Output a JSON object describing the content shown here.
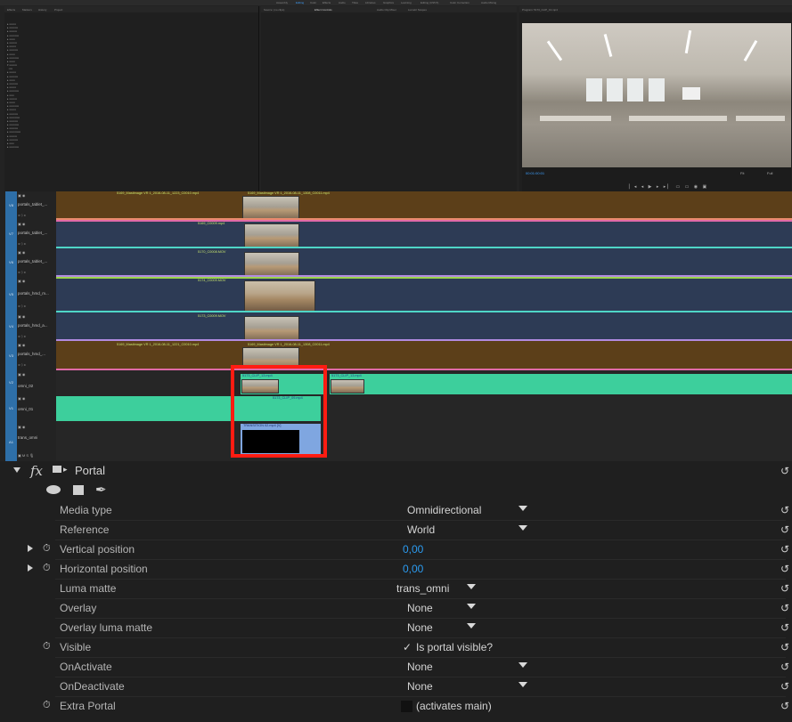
{
  "workspace": {
    "tabs": [
      "Assembly",
      "Editing",
      "Color",
      "Effects",
      "Audio",
      "Titles",
      "Libraries",
      "Graphics",
      "Learning",
      "Editing (CS5.5)",
      "Color Correction",
      "Audio Mixing"
    ],
    "left_panel_header": [
      "Effects",
      "Markers",
      "History",
      "Project"
    ],
    "mid_panel_header": [
      "Source: (no clips)",
      "Effect Controls",
      "Audio Clip Mixer",
      "Lumetri Scopes"
    ],
    "right_panel_header": "Program: 5173_CLIP_13.mp4",
    "monitor_timecode": "00:01:00:01",
    "monitor_zoom": "Fit",
    "monitor_quality": "Full"
  },
  "timeline": {
    "tracks": [
      {
        "id": "V8",
        "name": "portals_tablet_..."
      },
      {
        "id": "V7",
        "name": "portals_tablet_..."
      },
      {
        "id": "V6",
        "name": "portals_tablet_..."
      },
      {
        "id": "V5",
        "name": "portals_hmd_m..."
      },
      {
        "id": "V4",
        "name": "portals_hmd_a..."
      },
      {
        "id": "V3",
        "name": "portals_hmd_..."
      },
      {
        "id": "V2",
        "name": "omni_02"
      },
      {
        "id": "V1",
        "name": "omni_01"
      },
      {
        "id": "A1",
        "name": "trans_omni"
      }
    ],
    "clips": {
      "v8_left": "5169_Mastimage VR 1_2016-08-11_1223_C0010.mp4",
      "v8_right": "5169_Mastimage VR 1_2016-08-11_1308_C0011.mp4",
      "v7": "5169_C0009.mp4",
      "v6": "5170_C0008.MOV",
      "v5": "5174_C0009.MOV",
      "v4": "5173_C0009.MOV",
      "v3_left": "5169_Mastimage VR 1_2016-08-11_1221_C0010.mp4",
      "v3_right": "5169_Mastimage VR 1_2016-08-11_1308_C0011.mp4",
      "v2_a": "5173_CLIP_13.mp4",
      "v2_b": "5173_CLIP_13.mp4",
      "v1": "5173_CLIP_09.mp4",
      "trans": "TRANSITION 02.mp4 [V]"
    }
  },
  "effect": {
    "name": "Portal",
    "fx_label": "fx",
    "rows": [
      {
        "label": "Media type",
        "value": "Omnidirectional"
      },
      {
        "label": "Reference",
        "value": "World"
      },
      {
        "label": "Vertical position",
        "value": "0,00"
      },
      {
        "label": "Horizontal position",
        "value": "0,00"
      },
      {
        "label": "Luma matte",
        "value": "trans_omni"
      },
      {
        "label": "Overlay",
        "value": "None"
      },
      {
        "label": "Overlay luma matte",
        "value": "None"
      },
      {
        "label": "Visible",
        "value": "Is portal visible?"
      },
      {
        "label": "OnActivate",
        "value": "None"
      },
      {
        "label": "OnDeactivate",
        "value": "None"
      },
      {
        "label": "Extra Portal",
        "value": "(activates main)"
      }
    ],
    "checkmark": "✓",
    "reset_icon": "↺"
  }
}
